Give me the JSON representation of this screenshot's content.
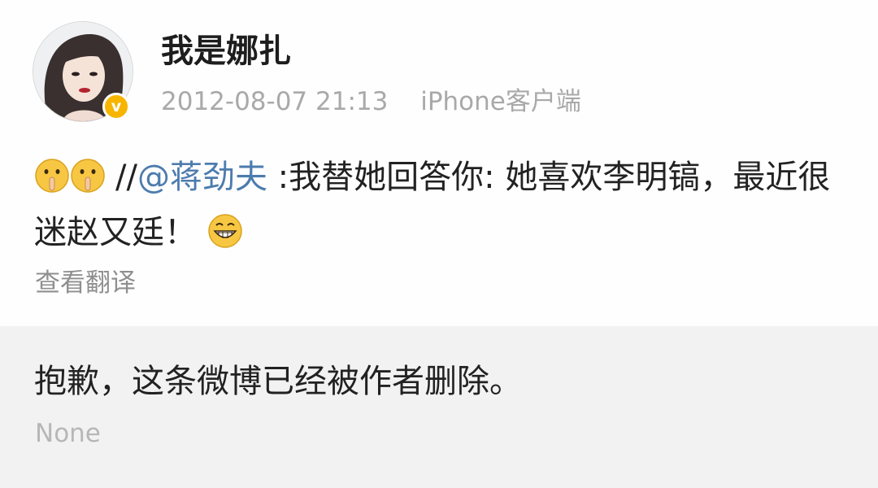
{
  "post": {
    "username": "我是娜扎",
    "timestamp": "2012-08-07 21:13",
    "source": "iPhone客户端",
    "verified_badge_label": "v",
    "badge_color": "#f7b500",
    "content": {
      "emojis_leading": [
        "shush-emoji",
        "shush-emoji"
      ],
      "slashes": "//",
      "mention": "@蒋劲夫",
      "mention_color": "#4d7cad",
      "text": " :我替她回答你: 她喜欢李明镐，最近很迷赵又廷！",
      "emoji_trailing": "grin-emoji"
    },
    "translate_label": "查看翻译"
  },
  "retweet": {
    "deleted_message": "抱歉，这条微博已经被作者删除。",
    "none_label": "None"
  }
}
